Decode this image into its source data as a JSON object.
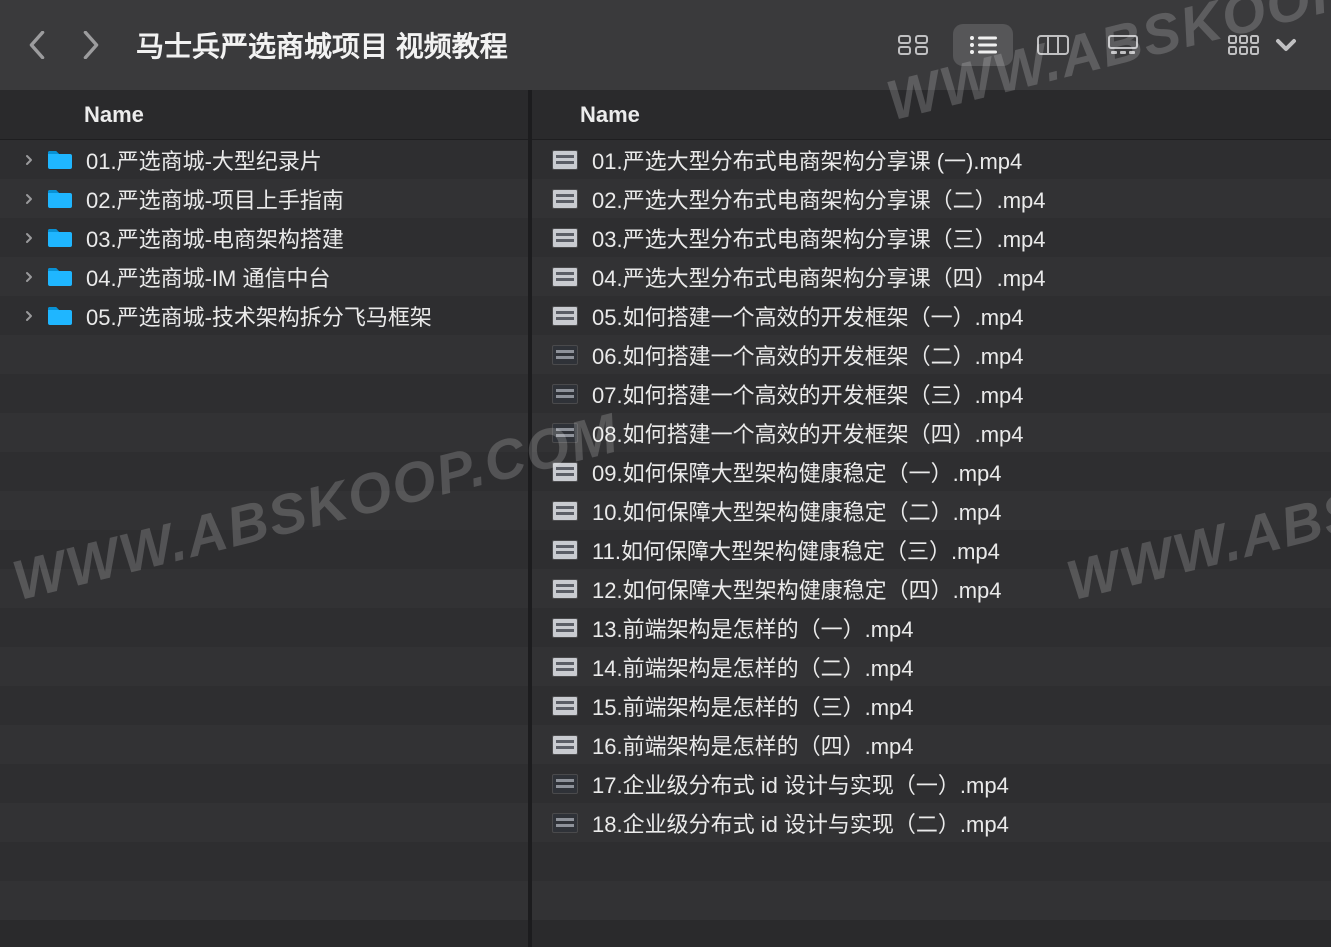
{
  "window": {
    "title": "马士兵严选商城项目 视频教程"
  },
  "columns": {
    "left_header": "Name",
    "right_header": "Name"
  },
  "folders": [
    {
      "name": "01.严选商城-大型纪录片"
    },
    {
      "name": "02.严选商城-项目上手指南"
    },
    {
      "name": "03.严选商城-电商架构搭建"
    },
    {
      "name": "04.严选商城-IM 通信中台"
    },
    {
      "name": "05.严选商城-技术架构拆分飞马框架"
    }
  ],
  "files": [
    {
      "name": "01.严选大型分布式电商架构分享课 (一).mp4",
      "thumb": "light"
    },
    {
      "name": "02.严选大型分布式电商架构分享课（二）.mp4",
      "thumb": "light"
    },
    {
      "name": "03.严选大型分布式电商架构分享课（三）.mp4",
      "thumb": "light"
    },
    {
      "name": "04.严选大型分布式电商架构分享课（四）.mp4",
      "thumb": "light"
    },
    {
      "name": "05.如何搭建一个高效的开发框架（一）.mp4",
      "thumb": "light"
    },
    {
      "name": "06.如何搭建一个高效的开发框架（二）.mp4",
      "thumb": "dark"
    },
    {
      "name": "07.如何搭建一个高效的开发框架（三）.mp4",
      "thumb": "dark"
    },
    {
      "name": "08.如何搭建一个高效的开发框架（四）.mp4",
      "thumb": "dark"
    },
    {
      "name": "09.如何保障大型架构健康稳定（一）.mp4",
      "thumb": "light"
    },
    {
      "name": "10.如何保障大型架构健康稳定（二）.mp4",
      "thumb": "light"
    },
    {
      "name": "11.如何保障大型架构健康稳定（三）.mp4",
      "thumb": "light"
    },
    {
      "name": "12.如何保障大型架构健康稳定（四）.mp4",
      "thumb": "light"
    },
    {
      "name": "13.前端架构是怎样的（一）.mp4",
      "thumb": "light"
    },
    {
      "name": "14.前端架构是怎样的（二）.mp4",
      "thumb": "light"
    },
    {
      "name": "15.前端架构是怎样的（三）.mp4",
      "thumb": "light"
    },
    {
      "name": "16.前端架构是怎样的（四）.mp4",
      "thumb": "light"
    },
    {
      "name": "17.企业级分布式 id 设计与实现（一）.mp4",
      "thumb": "dark"
    },
    {
      "name": "18.企业级分布式 id 设计与实现（二）.mp4",
      "thumb": "dark"
    }
  ],
  "left_total_rows": 20,
  "right_total_rows": 20,
  "watermark_text": "WWW.ABSKOOP.COM",
  "colors": {
    "toolbar": "#3a3a3c",
    "row_odd": "#2e2e30",
    "row_even": "#323234",
    "folder": "#1fb6ff"
  }
}
